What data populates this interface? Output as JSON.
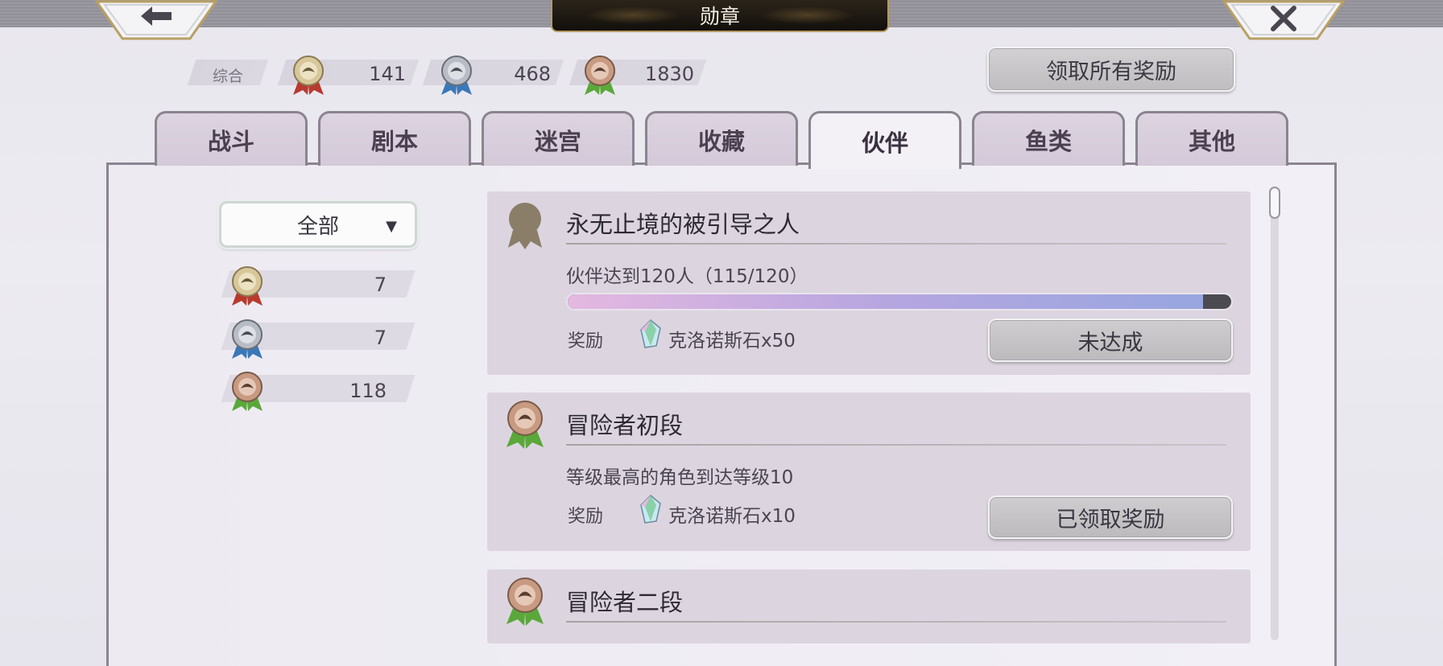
{
  "header": {
    "title": "勋章",
    "back_icon": "back-arrow-icon",
    "close_icon": "close-icon"
  },
  "summary": {
    "overall_label": "综合",
    "gold": "141",
    "silver": "468",
    "bronze": "1830"
  },
  "claim_all_label": "领取所有奖励",
  "tabs": [
    {
      "label": "战斗",
      "active": false
    },
    {
      "label": "剧本",
      "active": false
    },
    {
      "label": "迷宫",
      "active": false
    },
    {
      "label": "收藏",
      "active": false
    },
    {
      "label": "伙伴",
      "active": true
    },
    {
      "label": "鱼类",
      "active": false
    },
    {
      "label": "其他",
      "active": false
    }
  ],
  "filter": {
    "selected": "全部",
    "caret": "▼"
  },
  "side_counts": {
    "gold": "7",
    "silver": "7",
    "bronze": "118"
  },
  "medal_colors": {
    "gold": "#d8c79a",
    "silver": "#b8bcc4",
    "bronze": "#c89a82",
    "ribbon_red": "#b83a2e",
    "ribbon_blue": "#3a78b8",
    "ribbon_green": "#5aa83a"
  },
  "achievements": [
    {
      "title": "永无止境的被引导之人",
      "desc": "伙伴达到120人（115/120）",
      "progress": 0.958,
      "reward_label": "奖励",
      "reward": "克洛诺斯石x50",
      "button": "未达成",
      "medal": "locked"
    },
    {
      "title": "冒险者初段",
      "desc": "等级最高的角色到达等级10",
      "reward_label": "奖励",
      "reward": "克洛诺斯石x10",
      "button": "已领取奖励",
      "medal": "bronze"
    },
    {
      "title": "冒险者二段",
      "medal": "bronze"
    }
  ]
}
